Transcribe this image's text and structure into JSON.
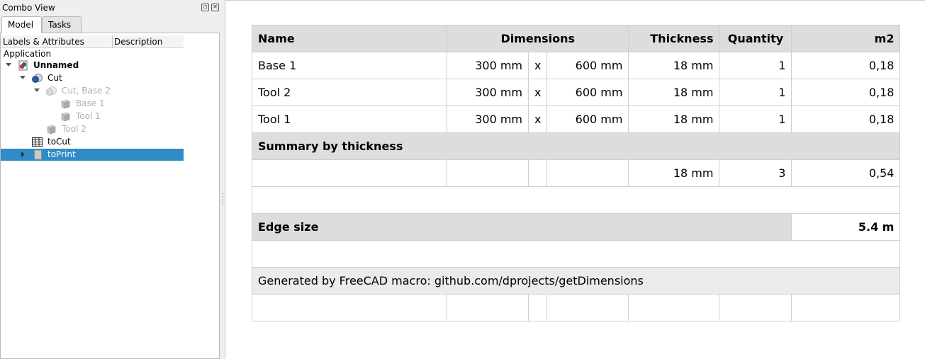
{
  "combo": {
    "title": "Combo View",
    "tabs": [
      {
        "label": "Model",
        "active": true
      },
      {
        "label": "Tasks",
        "active": false
      }
    ],
    "columns": [
      "Labels & Attributes",
      "Description"
    ],
    "tree": [
      {
        "label": "Application",
        "depth": 0,
        "icon": "none"
      },
      {
        "label": "Unnamed",
        "depth": 1,
        "icon": "document-icon",
        "expanded": true,
        "bold": true
      },
      {
        "label": "Cut",
        "depth": 2,
        "icon": "cut-icon",
        "expanded": true
      },
      {
        "label": "Cut, Base 2",
        "depth": 3,
        "icon": "cut-icon",
        "expanded": true,
        "faded": true
      },
      {
        "label": "Base 1",
        "depth": 4,
        "icon": "box-icon",
        "faded": true
      },
      {
        "label": "Tool 1",
        "depth": 4,
        "icon": "box-icon",
        "faded": true
      },
      {
        "label": "Tool 2",
        "depth": 3,
        "icon": "box-icon",
        "faded": true
      },
      {
        "label": "toCut",
        "depth": 2,
        "icon": "spreadsheet-icon"
      },
      {
        "label": "toPrint",
        "depth": 2,
        "icon": "page-icon",
        "collapsed": true,
        "selected": true
      }
    ]
  },
  "sheet": {
    "header": {
      "name": "Name",
      "dimensions": "Dimensions",
      "thickness": "Thickness",
      "quantity": "Quantity",
      "m2": "m2"
    },
    "rows": [
      {
        "name": "Base 1",
        "dim1": "300 mm",
        "x": "x",
        "dim2": "600 mm",
        "thickness": "18 mm",
        "quantity": "1",
        "m2": "0,18"
      },
      {
        "name": "Tool 2",
        "dim1": "300 mm",
        "x": "x",
        "dim2": "600 mm",
        "thickness": "18 mm",
        "quantity": "1",
        "m2": "0,18"
      },
      {
        "name": "Tool 1",
        "dim1": "300 mm",
        "x": "x",
        "dim2": "600 mm",
        "thickness": "18 mm",
        "quantity": "1",
        "m2": "0,18"
      }
    ],
    "summary_title": "Summary by thickness",
    "summary": {
      "thickness": "18 mm",
      "quantity": "3",
      "m2": "0,54"
    },
    "edge_label": "Edge size",
    "edge_value": "5.4 m",
    "footer": "Generated by FreeCAD macro: github.com/dprojects/getDimensions"
  }
}
